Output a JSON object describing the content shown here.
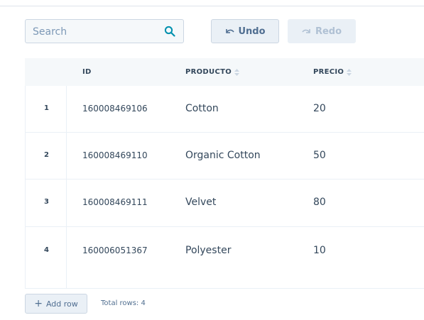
{
  "toolbar": {
    "search_placeholder": "Search",
    "undo_label": "Undo",
    "redo_label": "Redo"
  },
  "table": {
    "columns": [
      "ID",
      "PRODUCTO",
      "PRECIO"
    ],
    "rows": [
      {
        "num": "1",
        "id": "160008469106",
        "producto": "Cotton",
        "precio": "20"
      },
      {
        "num": "2",
        "id": "160008469110",
        "producto": "Organic Cotton",
        "precio": "50"
      },
      {
        "num": "3",
        "id": "160008469111",
        "producto": "Velvet",
        "precio": "80"
      },
      {
        "num": "4",
        "id": "160006051367",
        "producto": "Polyester",
        "precio": "10"
      }
    ]
  },
  "footer": {
    "add_row_label": "Add row",
    "total_rows": "Total rows: 4"
  },
  "colors": {
    "accent": "#0091ae",
    "text": "#33475b",
    "muted": "#7c98b6",
    "button_bg": "#eaf0f6"
  },
  "icons": {
    "search": "search-icon",
    "undo": "undo-icon",
    "redo": "redo-icon",
    "sort": "sort-icon",
    "add": "plus-icon"
  }
}
